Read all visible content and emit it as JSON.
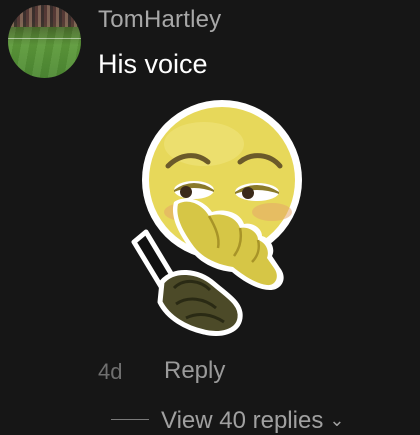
{
  "comment": {
    "username": "TomHartley",
    "text": "His voice",
    "age": "4d",
    "reply_label": "Reply",
    "view_replies_label": "View 40 replies",
    "avatar_icon": "stadium-avatar-icon",
    "sticker_icon": "embarrassed-emoji-phone-sticker"
  },
  "colors": {
    "background": "#161616",
    "username": "#a8a8a8",
    "text": "#ffffff",
    "muted": "#6f6f6f"
  }
}
